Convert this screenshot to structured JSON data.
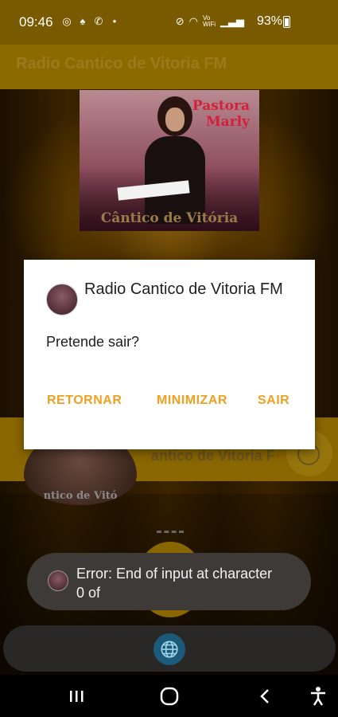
{
  "status_bar": {
    "time": "09:46",
    "battery": "93%",
    "left_icons": [
      "instagram-icon",
      "snapchat-icon",
      "whatsapp-icon",
      "dot-icon"
    ],
    "right_icons": [
      "mute-icon",
      "wifi-icon",
      "volte-icon",
      "signal-icon"
    ],
    "volte_label": "Vo)\nWiFi"
  },
  "app_bar": {
    "title": "Radio Cantico de Vitoria FM"
  },
  "cover": {
    "artist": "Pastora\nMarly",
    "album": "Cântico de Vitória"
  },
  "now_playing": {
    "title": "antico de Vitoria F",
    "avatar_caption": "ntico de Vitó"
  },
  "dialog": {
    "title": "Radio Cantico de Vitoria FM",
    "message": "Pretende sair?",
    "buttons": {
      "retornar": "RETORNAR",
      "minimizar": "MINIMIZAR",
      "sair": "SAIR"
    },
    "accent_color": "#f0a020"
  },
  "toast": {
    "text": "Error: End of input at character 0 of"
  },
  "colors": {
    "status_bar": "#7a5a00",
    "app_bar": "#8b6a00",
    "toast_bg": "#3e3a38"
  }
}
